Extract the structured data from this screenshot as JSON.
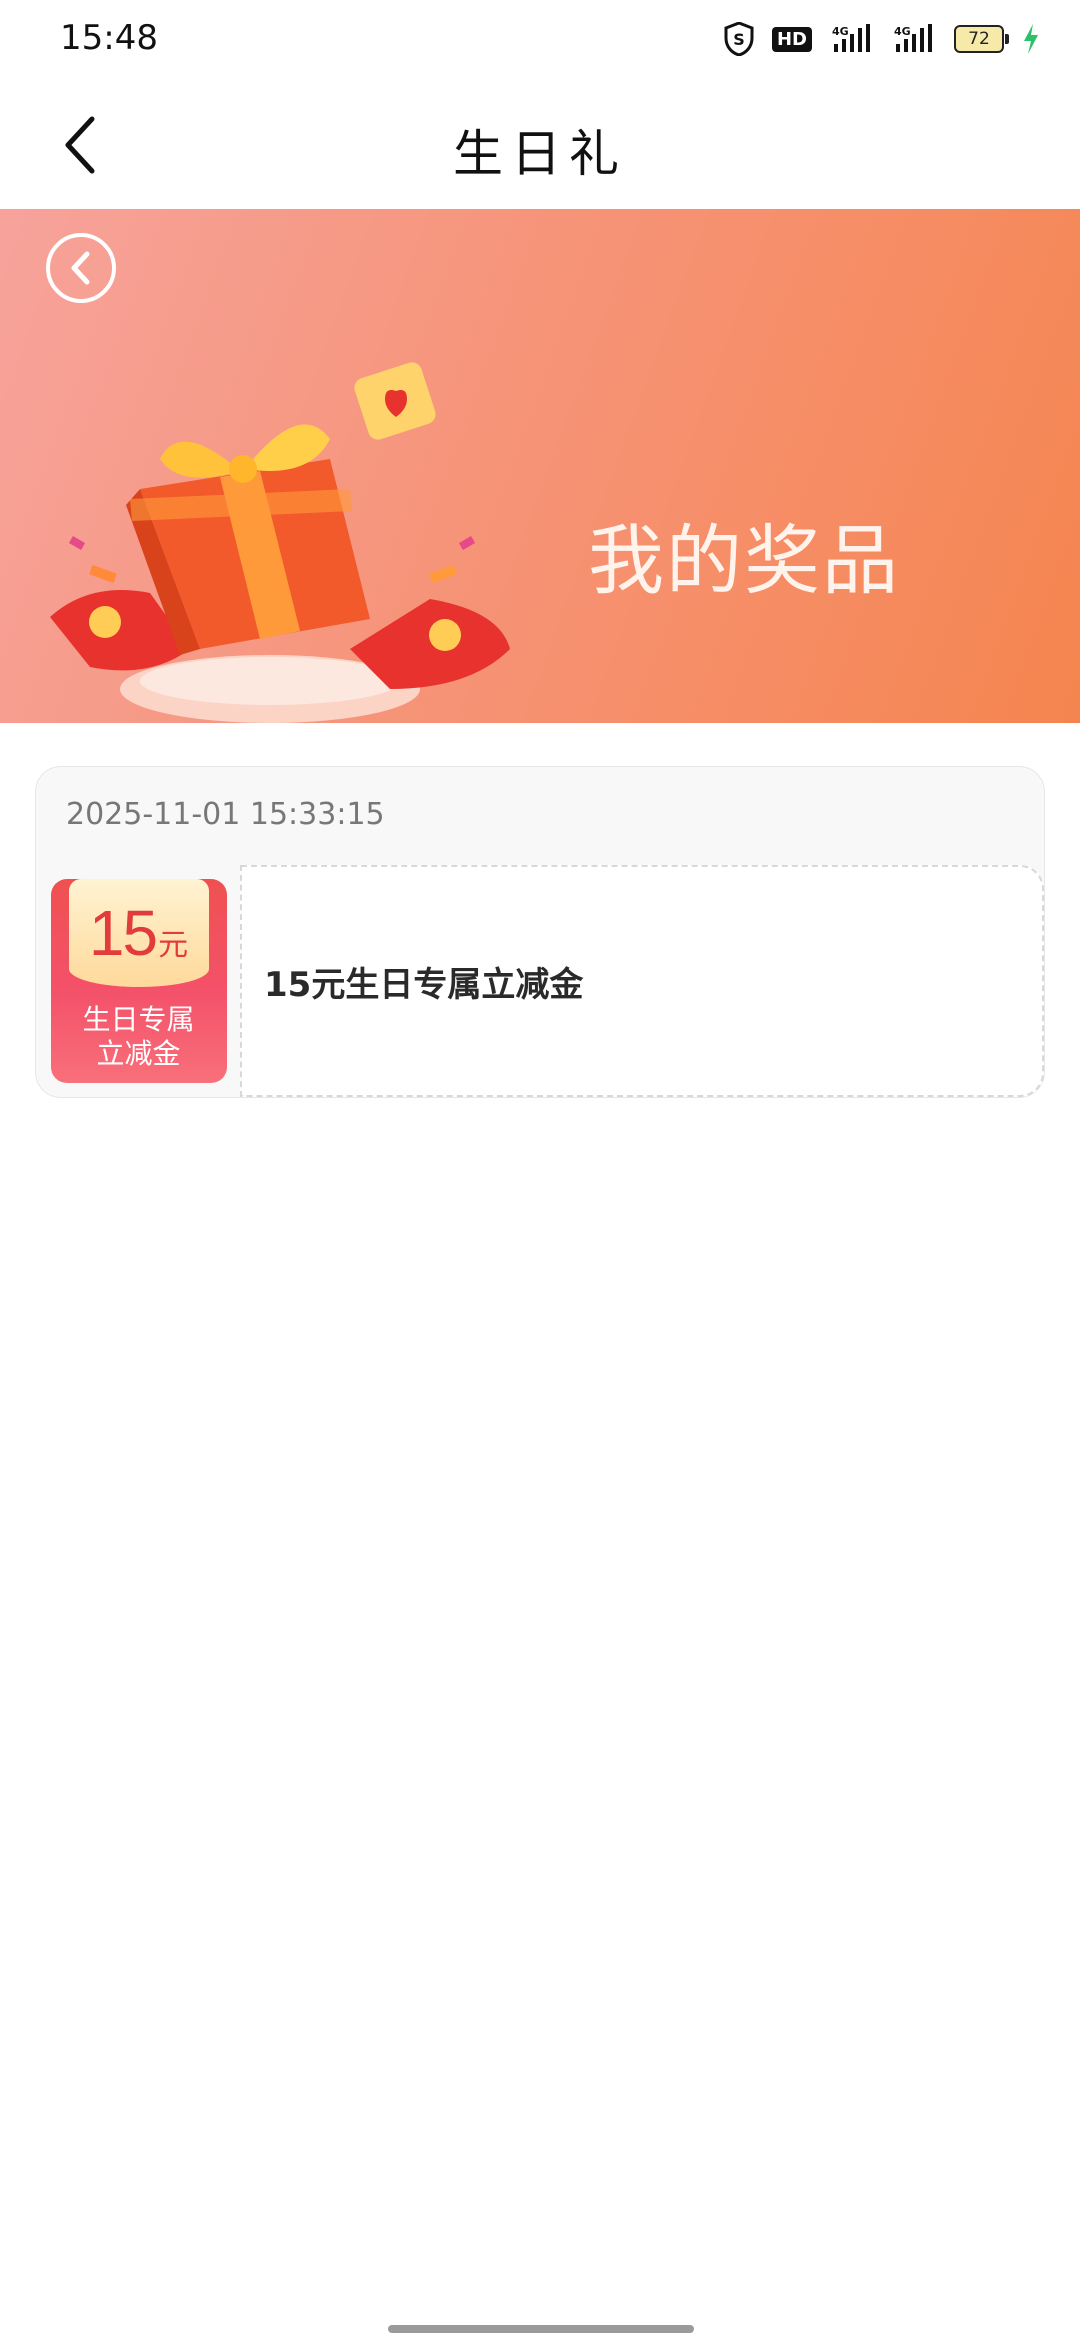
{
  "status_bar": {
    "time": "15:48",
    "signal1_label": "4G",
    "signal2_label": "4G",
    "battery_level": "72",
    "hd_label": "HD"
  },
  "header": {
    "title": "生日礼"
  },
  "banner": {
    "title": "我的奖品",
    "gradient_start": "#f7a39b",
    "gradient_end": "#f5854f"
  },
  "prizes": [
    {
      "date": "2025-11-01 15:33:15",
      "coupon_amount": "15",
      "coupon_unit": "元",
      "coupon_caption_line1": "生日专属",
      "coupon_caption_line2": "立减金",
      "name": "15元生日专属立减金"
    }
  ],
  "icons": {
    "back": "chevron-left-icon",
    "banner_back": "circle-chevron-left-icon",
    "shield": "shield-icon",
    "charging": "lightning-bolt-icon"
  }
}
